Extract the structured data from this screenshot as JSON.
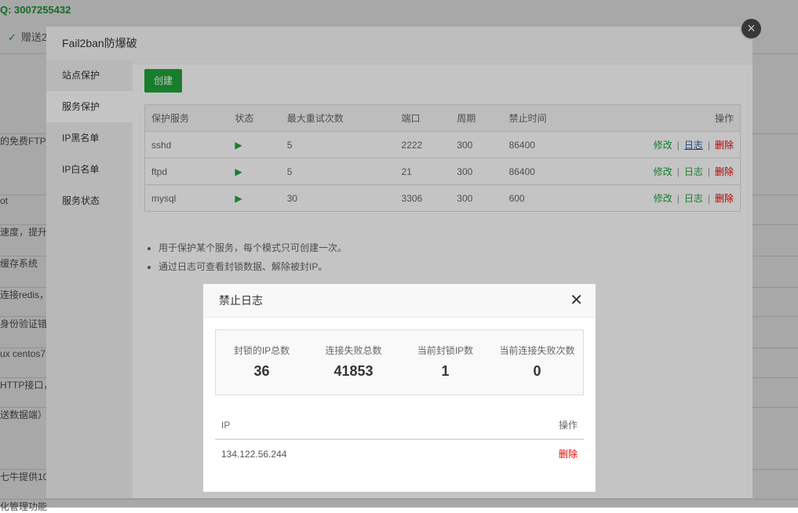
{
  "background": {
    "qq": "Q: 3007255432",
    "gift": "赠送2",
    "rows": [
      "的免费FTP服",
      "ot",
      "速度，提升",
      "缓存系统",
      "连接redis，则",
      "身份验证错",
      "ux centos7",
      "HTTP接口，",
      "送数据端）",
      "七牛提供10",
      "化管理功能"
    ]
  },
  "dialog": {
    "title": "Fail2ban防爆破",
    "close_icon": "close-circle-icon",
    "sidebar": [
      {
        "label": "站点保护"
      },
      {
        "label": "服务保护",
        "active": true
      },
      {
        "label": "IP黑名单"
      },
      {
        "label": "IP白名单"
      },
      {
        "label": "服务状态"
      }
    ],
    "create_label": "创建",
    "columns": [
      "保护服务",
      "状态",
      "最大重试次数",
      "端口",
      "周期",
      "禁止时间",
      "操作"
    ],
    "rows": [
      {
        "service": "sshd",
        "max_retry": "5",
        "port": "2222",
        "period": "300",
        "ban_time": "86400"
      },
      {
        "service": "ftpd",
        "max_retry": "5",
        "port": "21",
        "period": "300",
        "ban_time": "86400"
      },
      {
        "service": "mysql",
        "max_retry": "30",
        "port": "3306",
        "period": "300",
        "ban_time": "600"
      }
    ],
    "actions": {
      "edit": "修改",
      "log": "日志",
      "delete": "删除",
      "sep": "|"
    },
    "tips": [
      "用于保护某个服务，每个模式只可创建一次。",
      "通过日志可查看封锁数据、解除被封IP。"
    ]
  },
  "log_dialog": {
    "title": "禁止日志",
    "close": "✕",
    "stats": [
      {
        "label": "封锁的IP总数",
        "value": "36"
      },
      {
        "label": "连接失败总数",
        "value": "41853"
      },
      {
        "label": "当前封锁IP数",
        "value": "1"
      },
      {
        "label": "当前连接失败次数",
        "value": "0"
      }
    ],
    "columns": [
      "IP",
      "操作"
    ],
    "rows": [
      {
        "ip": "134.122.56.244",
        "action": "删除"
      }
    ]
  },
  "colors": {
    "accent": "#20a53a",
    "danger": "#e00000"
  }
}
